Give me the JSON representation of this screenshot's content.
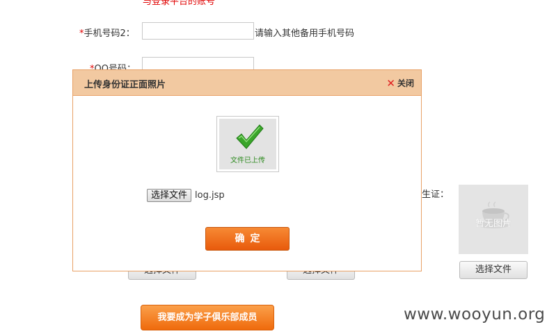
{
  "form": {
    "top_cutoff_text": "与登录平台的账号",
    "phone2": {
      "required_mark": "*",
      "label": "手机号码2：",
      "value": "",
      "hint": "请输入其他备用手机号码"
    },
    "qq": {
      "required_mark": "*",
      "label": "QQ号码：",
      "value": ""
    },
    "student_card_label": "生证：",
    "no_image_text": "暂无图片",
    "choose_file_buttons": [
      "选择文件",
      "选择文件",
      "选择文件"
    ],
    "join_button": "我要成为学子俱乐部成员"
  },
  "dialog": {
    "title": "上传身份证正面照片",
    "close_label": "关闭",
    "uploaded_text": "文件已上传",
    "file_button": "选择文件",
    "file_name": "log.jsp",
    "confirm_button": "确定"
  },
  "watermark": "www.wooyun.org",
  "colors": {
    "accent_orange": "#ef6a0c",
    "dialog_header": "#f2c9a1",
    "dialog_border": "#e8a065",
    "required_red": "#e00000",
    "check_green": "#3aa52a"
  },
  "icons": {
    "close": "close-icon",
    "uploaded": "checkmark-icon",
    "no_image": "coffee-cup-icon"
  }
}
